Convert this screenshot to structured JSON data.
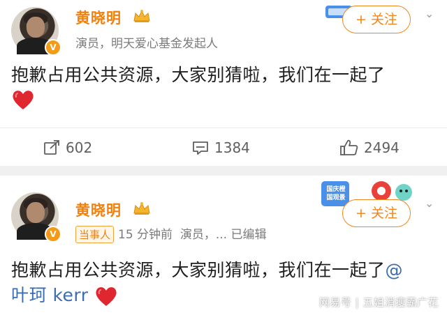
{
  "post1": {
    "username": "黄晓明",
    "bio": "演员，明天爱心基金发起人",
    "follow_label": "+ 关注",
    "text": "抱歉占用公共资源，大家别猜啦，我们在一起了",
    "repost_count": "602",
    "comment_count": "1384",
    "like_count": "2494"
  },
  "post2": {
    "username": "黄晓明",
    "tag": "当事人",
    "time": "15 分钟前",
    "meta_rest": "演员，... 已编辑",
    "follow_label": "+ 关注",
    "sticker_text": "国庆橙 国观景",
    "text": "抱歉占用公共资源，大家别猜啦，我们在一起了",
    "mention_at": "@",
    "mention_name": "叶珂 kerr"
  },
  "verified_badge": "V",
  "watermark": "网易号 | 五姐消瘦霸广花",
  "colors": {
    "username": "#f0810e",
    "follow": "#f0861c",
    "mention": "#3b6eb0",
    "heart": "#e0262f",
    "verified": "#f39b19"
  },
  "icons": [
    "crown-icon",
    "repost-icon",
    "comment-icon",
    "like-icon",
    "heart-emoji",
    "chevron-down-icon",
    "verified-icon"
  ]
}
